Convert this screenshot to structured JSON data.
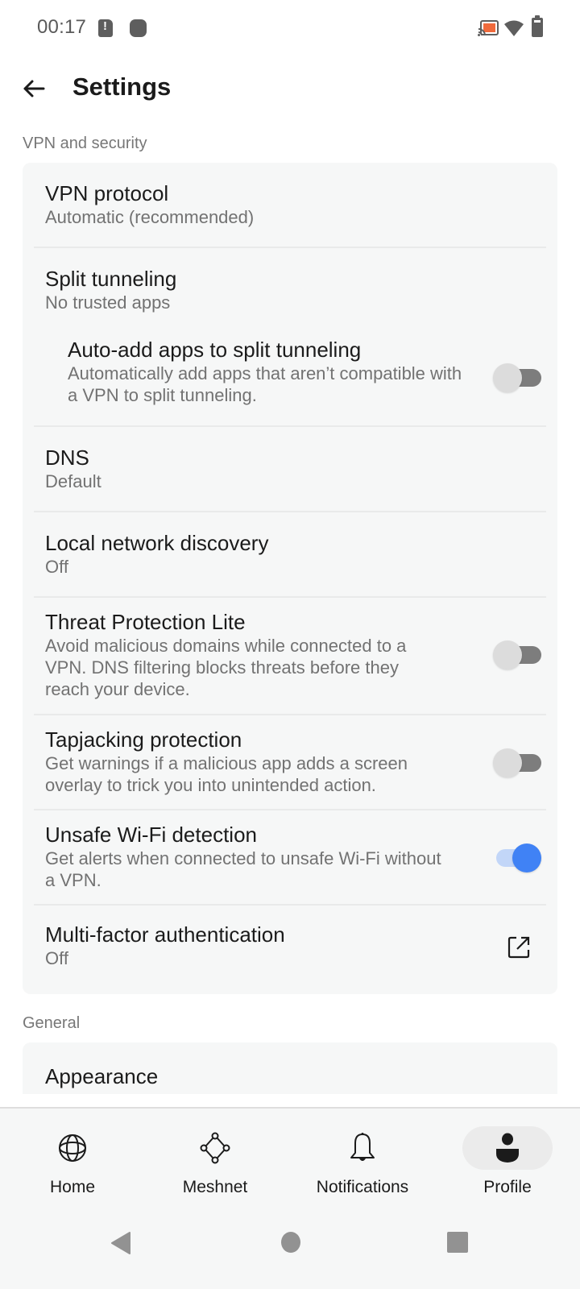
{
  "status_bar": {
    "time": "00:17",
    "icons": [
      "sim-alert-icon",
      "shield-icon",
      "cast-icon",
      "wifi-icon",
      "battery-icon"
    ],
    "cast_color": "#f06a3c"
  },
  "header": {
    "back_icon": "arrow-left-icon",
    "title": "Settings"
  },
  "sections": [
    {
      "label": "VPN and security",
      "items": [
        {
          "title": "VPN protocol",
          "subtitle": "Automatic (recommended)",
          "control": "none"
        },
        {
          "title": "Split tunneling",
          "subtitle": "No trusted apps",
          "control": "none"
        },
        {
          "title": "Auto-add apps to split tunneling",
          "subtitle": "Automatically add apps that aren’t compatible with a VPN to split tunneling.",
          "control": "toggle",
          "enabled": false,
          "indented": true
        },
        {
          "title": "DNS",
          "subtitle": "Default",
          "control": "none"
        },
        {
          "title": "Local network discovery",
          "subtitle": "Off",
          "control": "none"
        },
        {
          "title": "Threat Protection Lite",
          "subtitle": "Avoid malicious domains while connected to a VPN. DNS filtering blocks threats before they reach your device.",
          "control": "toggle",
          "enabled": false
        },
        {
          "title": "Tapjacking protection",
          "subtitle": "Get warnings if a malicious app adds a screen overlay to trick you into unintended action.",
          "control": "toggle",
          "enabled": false
        },
        {
          "title": "Unsafe Wi-Fi detection",
          "subtitle": "Get alerts when connected to unsafe Wi-Fi without a VPN.",
          "control": "toggle",
          "enabled": true
        },
        {
          "title": "Multi-factor authentication",
          "subtitle": "Off",
          "control": "external-link"
        }
      ]
    },
    {
      "label": "General",
      "items": [
        {
          "title": "Appearance"
        }
      ]
    }
  ],
  "bottom_nav": {
    "items": [
      {
        "label": "Home",
        "icon": "globe-icon",
        "active": false
      },
      {
        "label": "Meshnet",
        "icon": "meshnet-icon",
        "active": false
      },
      {
        "label": "Notifications",
        "icon": "bell-icon",
        "active": false
      },
      {
        "label": "Profile",
        "icon": "person-icon",
        "active": true
      }
    ]
  },
  "system_nav": {
    "buttons": [
      "back-triangle-icon",
      "home-circle-icon",
      "recents-square-icon"
    ]
  },
  "colors": {
    "accent": "#4082f5",
    "accent_track": "#c2d6f8",
    "card_bg": "#f6f7f7",
    "subtitle": "#727272"
  }
}
